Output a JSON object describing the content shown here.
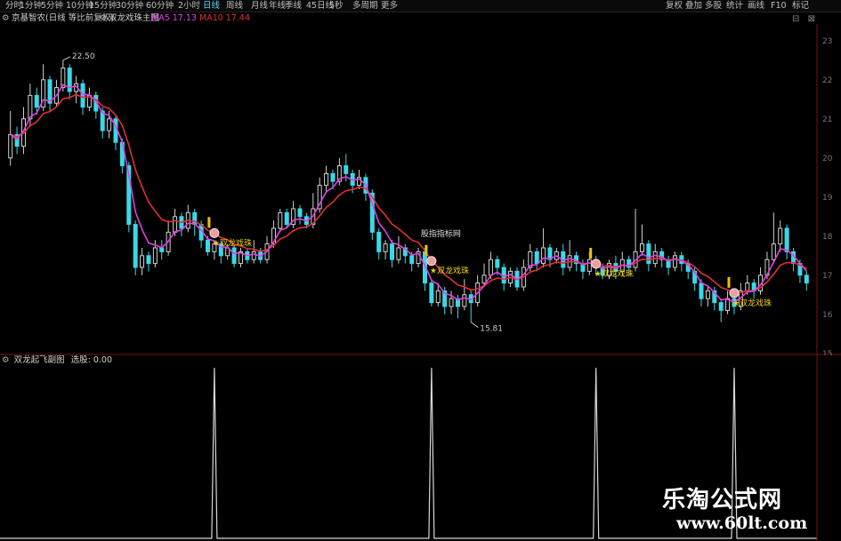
{
  "toolbar": {
    "left": [
      "分时",
      "1分钟",
      "5分钟",
      "10分钟",
      "15分钟",
      "30分钟",
      "60分钟",
      "2小时",
      "日线",
      "周线",
      "月线",
      "年线",
      "季线",
      "45日线",
      "5秒",
      "多周期",
      "更多"
    ],
    "active": "日线",
    "right": [
      "复权",
      "叠加",
      "多股",
      "统计",
      "画线",
      "F10",
      "标记"
    ]
  },
  "info": {
    "stock": "京基智农(日线 等比前复权)",
    "indicator": "双龙戏珠主图",
    "ma5": "MA5 17.13",
    "ma10": "MA10 17.44",
    "ma5_color": "#e040e0",
    "ma10_color": "#e03030"
  },
  "sub": {
    "title": "双龙起飞副图",
    "label": "选股: 0.00"
  },
  "annotations": {
    "high": "22.50",
    "low": "15.81",
    "signal": "★双龙戏珠",
    "site_tag": "股指指标网"
  },
  "right_axis": [
    "23",
    "22",
    "21",
    "20",
    "19",
    "18",
    "17",
    "16",
    "15"
  ],
  "watermark": {
    "title": "乐淘公式网",
    "url": "www.60lt.com"
  },
  "chart_data": {
    "type": "candlestick",
    "ylim": [
      15.2,
      23.2
    ],
    "colors": {
      "up": "#d0d0d0",
      "down": "#3ad8e8",
      "ma5": "#e040e0",
      "ma10": "#e03030"
    },
    "candles": [
      [
        20.0,
        20.6,
        21.2,
        19.8
      ],
      [
        20.6,
        20.3,
        20.8,
        20.1
      ],
      [
        20.3,
        21.0,
        21.3,
        20.1
      ],
      [
        21.0,
        21.6,
        21.9,
        20.8
      ],
      [
        21.6,
        21.3,
        21.8,
        21.1
      ],
      [
        21.3,
        22.0,
        22.4,
        21.2
      ],
      [
        22.0,
        21.4,
        22.1,
        21.2
      ],
      [
        21.4,
        21.8,
        22.0,
        21.3
      ],
      [
        21.8,
        22.3,
        22.5,
        21.7
      ],
      [
        22.3,
        21.7,
        22.4,
        21.5
      ],
      [
        21.7,
        21.9,
        22.1,
        21.4
      ],
      [
        21.9,
        21.3,
        22.0,
        21.1
      ],
      [
        21.3,
        21.6,
        21.8,
        21.2
      ],
      [
        21.6,
        21.2,
        21.7,
        21.0
      ],
      [
        21.2,
        20.7,
        21.3,
        20.5
      ],
      [
        20.7,
        21.0,
        21.2,
        20.5
      ],
      [
        21.0,
        20.4,
        21.1,
        20.2
      ],
      [
        20.4,
        19.8,
        20.5,
        19.6
      ],
      [
        19.8,
        18.3,
        19.9,
        18.1
      ],
      [
        18.3,
        17.2,
        18.4,
        17.0
      ],
      [
        17.2,
        17.5,
        17.7,
        17.0
      ],
      [
        17.5,
        17.3,
        17.6,
        17.1
      ],
      [
        17.3,
        17.7,
        17.9,
        17.2
      ],
      [
        17.7,
        17.6,
        17.9,
        17.4
      ],
      [
        17.6,
        18.1,
        18.4,
        17.5
      ],
      [
        18.1,
        18.5,
        18.7,
        18.0
      ],
      [
        18.5,
        18.2,
        18.6,
        18.0
      ],
      [
        18.2,
        18.6,
        18.8,
        18.1
      ],
      [
        18.6,
        18.3,
        18.7,
        18.0
      ],
      [
        18.3,
        17.9,
        18.4,
        17.7
      ],
      [
        17.9,
        17.6,
        18.0,
        17.5
      ],
      [
        17.6,
        17.8,
        17.9,
        17.4
      ],
      [
        17.8,
        17.5,
        17.9,
        17.3
      ],
      [
        17.5,
        17.7,
        17.8,
        17.4
      ],
      [
        17.7,
        17.3,
        17.8,
        17.2
      ],
      [
        17.3,
        17.6,
        17.7,
        17.2
      ],
      [
        17.6,
        17.4,
        17.7,
        17.3
      ],
      [
        17.4,
        17.6,
        17.9,
        17.3
      ],
      [
        17.6,
        17.4,
        17.7,
        17.3
      ],
      [
        17.4,
        17.8,
        18.0,
        17.3
      ],
      [
        17.8,
        18.2,
        18.4,
        17.7
      ],
      [
        18.2,
        18.6,
        18.7,
        18.1
      ],
      [
        18.6,
        18.3,
        18.7,
        18.2
      ],
      [
        18.3,
        18.7,
        18.9,
        18.2
      ],
      [
        18.7,
        18.5,
        18.8,
        18.3
      ],
      [
        18.5,
        18.3,
        18.6,
        18.2
      ],
      [
        18.3,
        18.7,
        19.1,
        18.2
      ],
      [
        18.7,
        19.3,
        19.5,
        18.6
      ],
      [
        19.3,
        19.6,
        19.8,
        19.1
      ],
      [
        19.6,
        19.4,
        19.7,
        19.2
      ],
      [
        19.4,
        19.8,
        20.0,
        19.3
      ],
      [
        19.8,
        19.6,
        20.1,
        19.4
      ],
      [
        19.6,
        19.3,
        19.7,
        19.1
      ],
      [
        19.3,
        19.5,
        19.7,
        19.2
      ],
      [
        19.5,
        19.1,
        19.6,
        18.9
      ],
      [
        19.1,
        18.1,
        19.2,
        17.9
      ],
      [
        18.1,
        17.6,
        18.2,
        17.4
      ],
      [
        17.6,
        17.8,
        17.9,
        17.4
      ],
      [
        17.8,
        17.4,
        17.9,
        17.2
      ],
      [
        17.4,
        17.7,
        18.0,
        17.3
      ],
      [
        17.7,
        17.5,
        17.8,
        17.3
      ],
      [
        17.5,
        17.3,
        17.6,
        17.1
      ],
      [
        17.3,
        17.6,
        17.7,
        17.2
      ],
      [
        17.6,
        16.8,
        17.7,
        16.6
      ],
      [
        16.8,
        16.3,
        16.9,
        16.2
      ],
      [
        16.3,
        16.6,
        16.8,
        16.2
      ],
      [
        16.6,
        16.2,
        16.7,
        16.0
      ],
      [
        16.2,
        16.4,
        16.6,
        16.0
      ],
      [
        16.4,
        16.2,
        16.5,
        15.9
      ],
      [
        16.2,
        16.5,
        16.9,
        16.1
      ],
      [
        16.5,
        16.3,
        16.6,
        15.8
      ],
      [
        16.3,
        16.8,
        17.0,
        16.2
      ],
      [
        16.8,
        17.0,
        17.3,
        16.7
      ],
      [
        17.0,
        17.4,
        17.6,
        16.9
      ],
      [
        17.4,
        17.2,
        17.5,
        17.0
      ],
      [
        17.2,
        16.8,
        17.3,
        16.6
      ],
      [
        16.8,
        17.1,
        17.2,
        16.7
      ],
      [
        17.1,
        16.7,
        17.2,
        16.6
      ],
      [
        16.7,
        17.2,
        17.4,
        16.6
      ],
      [
        17.2,
        17.6,
        17.8,
        17.1
      ],
      [
        17.6,
        17.3,
        17.7,
        17.1
      ],
      [
        17.3,
        17.7,
        18.2,
        17.2
      ],
      [
        17.7,
        17.4,
        17.8,
        17.2
      ],
      [
        17.4,
        17.6,
        17.7,
        17.3
      ],
      [
        17.6,
        17.2,
        17.8,
        17.0
      ],
      [
        17.2,
        17.5,
        17.9,
        17.1
      ],
      [
        17.5,
        17.3,
        17.6,
        17.1
      ],
      [
        17.3,
        17.1,
        17.4,
        16.9
      ],
      [
        17.1,
        17.4,
        17.6,
        17.0
      ],
      [
        17.4,
        17.2,
        17.5,
        17.0
      ],
      [
        17.2,
        17.0,
        17.3,
        16.9
      ],
      [
        17.0,
        17.3,
        17.4,
        16.9
      ],
      [
        17.3,
        17.1,
        17.5,
        16.9
      ],
      [
        17.1,
        17.4,
        17.6,
        17.0
      ],
      [
        17.4,
        17.2,
        17.5,
        17.0
      ],
      [
        17.2,
        17.6,
        18.7,
        17.1
      ],
      [
        17.6,
        17.8,
        18.3,
        17.5
      ],
      [
        17.8,
        17.3,
        17.9,
        17.1
      ],
      [
        17.3,
        17.6,
        17.8,
        17.2
      ],
      [
        17.6,
        17.4,
        17.7,
        17.2
      ],
      [
        17.4,
        17.2,
        17.5,
        17.0
      ],
      [
        17.2,
        17.5,
        17.6,
        17.1
      ],
      [
        17.5,
        17.3,
        17.6,
        17.1
      ],
      [
        17.3,
        17.1,
        17.4,
        16.9
      ],
      [
        17.1,
        16.8,
        17.2,
        16.6
      ],
      [
        16.8,
        16.4,
        16.9,
        16.2
      ],
      [
        16.4,
        16.6,
        16.7,
        16.2
      ],
      [
        16.6,
        16.3,
        16.7,
        16.1
      ],
      [
        16.3,
        16.1,
        16.4,
        15.8
      ],
      [
        16.1,
        16.4,
        16.6,
        16.0
      ],
      [
        16.4,
        16.2,
        16.5,
        16.0
      ],
      [
        16.2,
        16.6,
        16.8,
        16.1
      ],
      [
        16.6,
        16.8,
        17.0,
        16.5
      ],
      [
        16.8,
        16.6,
        16.9,
        16.4
      ],
      [
        16.6,
        17.0,
        17.2,
        16.5
      ],
      [
        17.0,
        17.4,
        17.6,
        16.9
      ],
      [
        17.4,
        17.8,
        18.6,
        17.3
      ],
      [
        17.8,
        18.2,
        18.4,
        17.6
      ],
      [
        18.2,
        17.6,
        18.3,
        17.4
      ],
      [
        17.6,
        17.3,
        17.7,
        17.1
      ],
      [
        17.3,
        17.0,
        17.4,
        16.8
      ],
      [
        17.0,
        16.8,
        17.1,
        16.6
      ]
    ],
    "signals": [
      31,
      64,
      89,
      110
    ],
    "sub_spikes": [
      31,
      64,
      89,
      110
    ]
  }
}
